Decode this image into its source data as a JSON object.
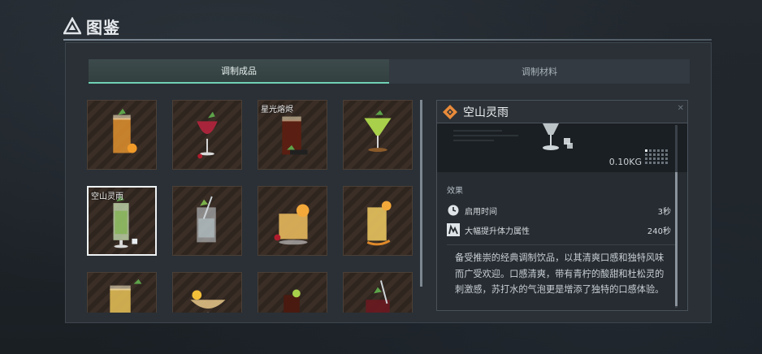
{
  "header": {
    "title": "图鉴"
  },
  "tabs": [
    {
      "label": "调制成品",
      "active": true
    },
    {
      "label": "调制材料",
      "active": false
    }
  ],
  "grid": {
    "items": [
      {
        "label": "",
        "drink": "orange-highball"
      },
      {
        "label": "",
        "drink": "red-wine-glass"
      },
      {
        "label": "星光熔烬",
        "drink": "dark-cola-tall"
      },
      {
        "label": "",
        "drink": "green-martini"
      },
      {
        "label": "空山灵雨",
        "drink": "mint-highball",
        "selected": true
      },
      {
        "label": "",
        "drink": "clear-highball"
      },
      {
        "label": "",
        "drink": "orange-rocks"
      },
      {
        "label": "",
        "drink": "yellow-highball"
      },
      {
        "label": "",
        "drink": "yellow-highball-2"
      },
      {
        "label": "",
        "drink": "coupe-glass"
      },
      {
        "label": "",
        "drink": "cola-tall"
      },
      {
        "label": "",
        "drink": "red-rocks"
      }
    ]
  },
  "detail": {
    "title": "空山灵雨",
    "close_label": "✕",
    "weight": "0.10KG",
    "effect_heading": "效果",
    "stats": [
      {
        "icon": "clock-icon",
        "label": "启用时间",
        "value": "3秒"
      },
      {
        "icon": "stamina-icon",
        "label": "大幅提升体力属性",
        "value": "240秒"
      }
    ],
    "description": "备受推崇的经典调制饮品，以其清爽口感和独特风味而广受欢迎。口感清爽，带有青柠的酸甜和杜松灵的刺激感，苏打水的气泡更是增添了独特的口感体验。"
  },
  "colors": {
    "accent": "#6fd1b5",
    "selected_border": "#eef2f4",
    "icon_orange": "#e88a3a"
  }
}
